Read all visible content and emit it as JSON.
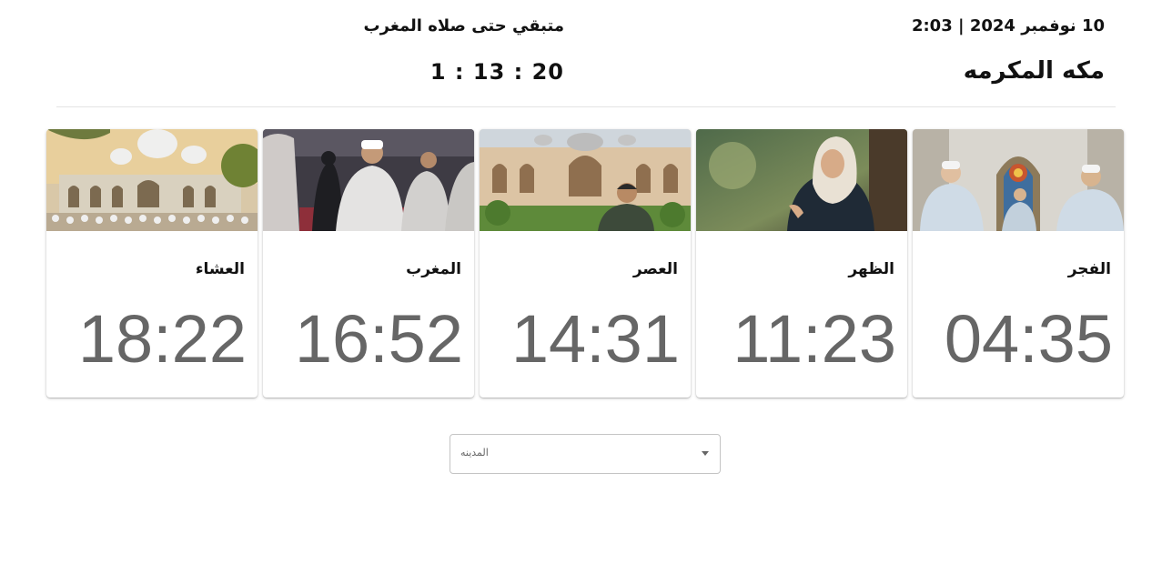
{
  "header": {
    "date_line": "10 نوفمبر 2024 | 2:03",
    "city": "مكه المكرمه",
    "remaining_label": "متبقي حتى صلاه المغرب",
    "countdown": "1 : 13 : 20"
  },
  "prayers": [
    {
      "name": "الفجر",
      "time": "04:35",
      "image": "men-praying-mosaic-window"
    },
    {
      "name": "الظهر",
      "time": "11:23",
      "image": "woman-praying-garden"
    },
    {
      "name": "العصر",
      "time": "14:31",
      "image": "man-in-mosque-courtyard"
    },
    {
      "name": "المغرب",
      "time": "16:52",
      "image": "worshippers-in-mosque-hall"
    },
    {
      "name": "العشاء",
      "time": "18:22",
      "image": "crowd-outside-mosque"
    }
  ],
  "city_select": {
    "placeholder": "المدينه",
    "icon": "dropdown-arrow-icon"
  }
}
